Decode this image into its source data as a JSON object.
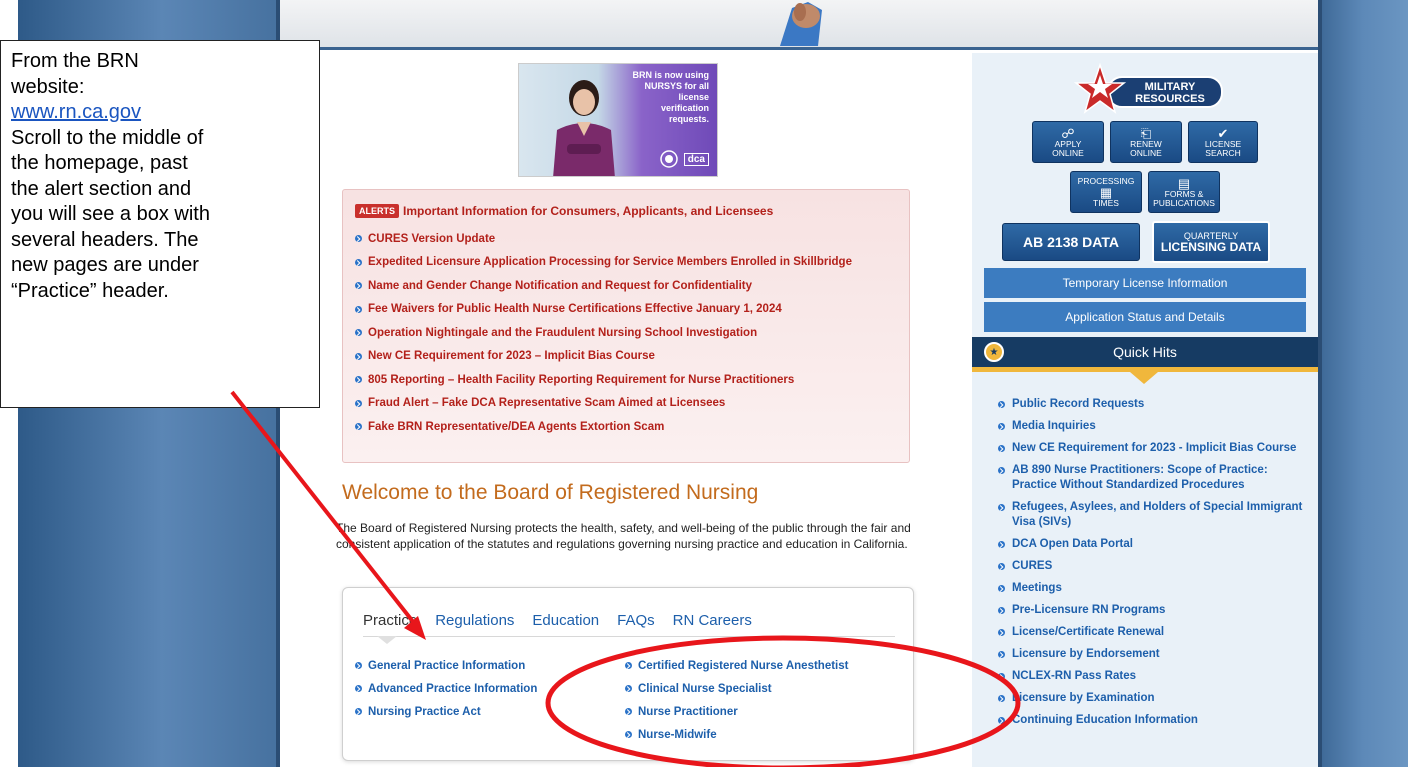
{
  "note": {
    "line1": "From the BRN",
    "line2": "website:",
    "url": "www.rn.ca.gov",
    "line3": "Scroll to the middle of",
    "line4": "the homepage, past",
    "line5": "the alert section and",
    "line6": "you will see a box with",
    "line7": "several headers.  The",
    "line8": "new pages are under",
    "line9": "“Practice” header."
  },
  "promo": {
    "text": "BRN is now using NURSYS for all license verification requests.",
    "logo_label": "dca"
  },
  "alerts": {
    "badge": "ALERTS",
    "title": "Important Information for Consumers, Applicants, and Licensees",
    "items": [
      "CURES Version Update",
      "Expedited Licensure Application Processing for Service Members Enrolled in Skillbridge",
      "Name and Gender Change Notification and Request for Confidentiality",
      "Fee Waivers for Public Health Nurse Certifications Effective January 1, 2024",
      "Operation Nightingale and the Fraudulent Nursing School Investigation",
      "New CE Requirement for 2023 – Implicit Bias Course",
      "805 Reporting – Health Facility Reporting Requirement for Nurse Practitioners",
      "Fraud Alert – Fake DCA Representative Scam Aimed at Licensees",
      "Fake BRN Representative/DEA Agents Extortion Scam"
    ]
  },
  "welcome": {
    "title": "Welcome to the Board of Registered Nursing",
    "text": "The Board of Registered Nursing protects the health, safety, and well-being of the public through the fair and consistent application of the statutes and regulations governing nursing practice and education in California."
  },
  "tabs": [
    "Practice",
    "Regulations",
    "Education",
    "FAQs",
    "RN Careers"
  ],
  "practice_links_left": [
    "General Practice Information",
    "Advanced Practice Information",
    "Nursing Practice Act"
  ],
  "practice_links_right": [
    "Certified Registered Nurse Anesthetist",
    "Clinical Nurse Specialist",
    "Nurse Practitioner",
    "Nurse-Midwife"
  ],
  "sidebar": {
    "military": [
      "MILITARY",
      "RESOURCES"
    ],
    "apply": [
      "APPLY",
      "ONLINE"
    ],
    "renew": [
      "RENEW",
      "ONLINE"
    ],
    "license": [
      "LICENSE",
      "SEARCH"
    ],
    "processing": [
      "PROCESSING",
      "TIMES"
    ],
    "forms": [
      "FORMS &",
      "PUBLICATIONS"
    ],
    "ab2138": "AB 2138 DATA",
    "quarterly": [
      "QUARTERLY",
      "LICENSING DATA"
    ],
    "temp_license": "Temporary License Information",
    "app_status": "Application Status and Details",
    "quick_hits": "Quick Hits",
    "quick_items": [
      "Public Record Requests",
      "Media Inquiries",
      "New CE Requirement for 2023 - Implicit Bias Course",
      "AB 890 Nurse Practitioners: Scope of Practice: Practice Without Standardized Procedures",
      "Refugees, Asylees, and Holders of Special Immigrant Visa (SIVs)",
      "DCA Open Data Portal",
      "CURES",
      "Meetings",
      "Pre-Licensure RN Programs",
      "License/Certificate Renewal",
      "Licensure by Endorsement",
      "NCLEX-RN Pass Rates",
      "Licensure by Examination",
      "Continuing Education Information"
    ]
  },
  "colors": {
    "alert_red": "#b3211b",
    "link_blue": "#1d5fab",
    "welcome_orange": "#c36b1d",
    "annotation_red": "#e8161b",
    "sidebar_blue": "#3c7cc0"
  }
}
